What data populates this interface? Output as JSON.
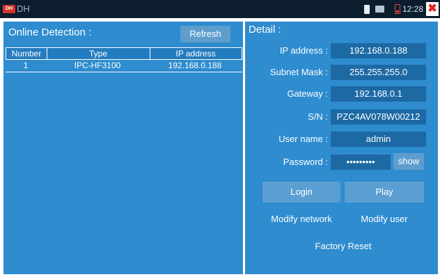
{
  "statusbar": {
    "logo_text": "DH",
    "app_title": "DH",
    "time": "12:28 PM",
    "close_glyph": "✖"
  },
  "online": {
    "title": "Online Detection :",
    "refresh_label": "Refresh",
    "columns": [
      "Number",
      "Type",
      "IP address"
    ],
    "rows": [
      {
        "number": "1",
        "type": "IPC-HF3100",
        "ip": "192.168.0.188"
      }
    ]
  },
  "detail": {
    "title": "Detail :",
    "fields": [
      {
        "label": "IP address :",
        "value": "192.168.0.188"
      },
      {
        "label": "Subnet Mask :",
        "value": "255.255.255.0"
      },
      {
        "label": "Gateway :",
        "value": "192.168.0.1"
      },
      {
        "label": "S/N :",
        "value": "PZC4AV078W00212"
      },
      {
        "label": "User name :",
        "value": "admin"
      },
      {
        "label": "Password :",
        "value": "•••••••••"
      }
    ],
    "show_label": "show",
    "buttons": {
      "login": "Login",
      "play": "Play",
      "modify_network": "Modify network",
      "modify_user": "Modify user",
      "factory_reset": "Factory Reset"
    }
  },
  "colors": {
    "panel": "#2e8ccf",
    "field": "#1d69a4",
    "button": "#5b9fd2",
    "statusbar": "#0c1d2e",
    "close": "#e0281c"
  },
  "icons": [
    "battery-icon",
    "monitor-icon",
    "low-battery-icon",
    "close-icon"
  ]
}
